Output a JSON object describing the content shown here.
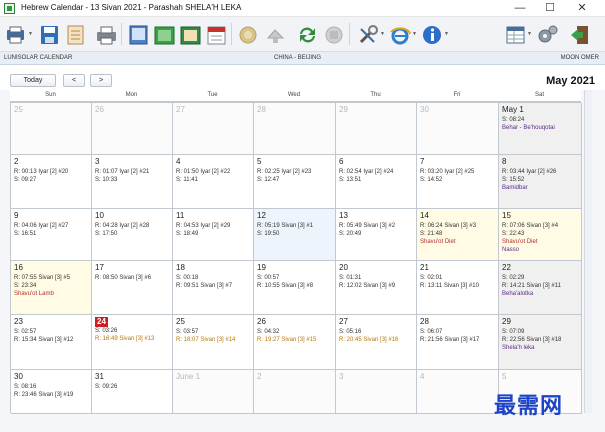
{
  "window": {
    "title": "Hebrew Calendar - 13 Sivan 2021 - Parashah SHELA'H LEKA"
  },
  "toolbar_icons": [
    "print-preview-icon",
    "save-icon",
    "open-file-icon",
    "print-icon",
    "tablet-icon",
    "green-calendar-icon",
    "tan-calendar-icon",
    "calendar-page-icon",
    "circle-disabled-icon",
    "lamp-disabled-icon",
    "refresh-icon",
    "stop-disabled-icon",
    "tools-icon",
    "gears-icon",
    "internet-explorer-icon",
    "info-icon",
    "table-view-icon",
    "settings-icon",
    "exit-door-icon"
  ],
  "infobar": {
    "left": "LUNISOLAR CALENDAR",
    "center": "CHINA - BEIJING",
    "right": "MOON OMER"
  },
  "nav": {
    "today": "Today",
    "prev": "<",
    "next": ">",
    "month_title": "May 2021"
  },
  "day_names": [
    "Sun",
    "Mon",
    "Tue",
    "Wed",
    "Thu",
    "Fri",
    "Sat"
  ],
  "colors": {
    "today_red": "#cc2020",
    "event_purple": "#5a2c86",
    "event_red": "#b03030",
    "event_orange": "#b8760a",
    "watermark_blue": "#1d43c8"
  },
  "weeks": [
    [
      {
        "day": "25",
        "out": true,
        "lines": [],
        "events": []
      },
      {
        "day": "26",
        "out": true,
        "lines": [],
        "events": []
      },
      {
        "day": "27",
        "out": true,
        "lines": [],
        "events": []
      },
      {
        "day": "28",
        "out": true,
        "lines": [],
        "events": []
      },
      {
        "day": "29",
        "out": true,
        "lines": [],
        "events": []
      },
      {
        "day": "30",
        "out": true,
        "lines": [],
        "events": []
      },
      {
        "day": "May 1",
        "style": "shaded",
        "lines": [
          "S: 08:24"
        ],
        "events": [
          {
            "text": "Behar - Be'houqotai",
            "color": "purple"
          }
        ]
      }
    ],
    [
      {
        "day": "2",
        "lines": [
          "R: 00:13 Iyar [2] #20",
          "S: 09:27"
        ],
        "events": []
      },
      {
        "day": "3",
        "lines": [
          "R: 01:07 Iyar [2] #21",
          "S: 10:33"
        ],
        "events": []
      },
      {
        "day": "4",
        "lines": [
          "R: 01:50 Iyar [2] #22",
          "S: 11:41"
        ],
        "events": []
      },
      {
        "day": "5",
        "lines": [
          "R: 02:25 Iyar [2] #23",
          "S: 12:47"
        ],
        "events": []
      },
      {
        "day": "6",
        "lines": [
          "R: 02:54 Iyar [2] #24",
          "S: 13:51"
        ],
        "events": []
      },
      {
        "day": "7",
        "lines": [
          "R: 03:20 Iyar [2] #25",
          "S: 14:52"
        ],
        "events": []
      },
      {
        "day": "8",
        "style": "shaded",
        "lines": [
          "R: 03:44 Iyar [2] #26",
          "S: 15:52"
        ],
        "events": [
          {
            "text": "Bamidbar",
            "color": "purple"
          }
        ]
      }
    ],
    [
      {
        "day": "9",
        "lines": [
          "R: 04:06 Iyar [2] #27",
          "S: 16:51"
        ],
        "events": []
      },
      {
        "day": "10",
        "lines": [
          "R: 04:28 Iyar [2] #28",
          "S: 17:50"
        ],
        "events": []
      },
      {
        "day": "11",
        "lines": [
          "R: 04:53 Iyar [2] #29",
          "S: 18:49"
        ],
        "events": []
      },
      {
        "day": "12",
        "style": "blue",
        "lines": [
          "R: 05:19 Sivan [3] #1",
          "S: 19:50"
        ],
        "events": []
      },
      {
        "day": "13",
        "lines": [
          "R: 05:49 Sivan [3] #2",
          "S: 20:49"
        ],
        "events": []
      },
      {
        "day": "14",
        "style": "yellow",
        "lines": [
          "R: 06:24 Sivan [3] #3",
          "S: 21:48"
        ],
        "events": [
          {
            "text": "Shavu'ot Diet",
            "color": "red"
          }
        ]
      },
      {
        "day": "15",
        "style": "yellow",
        "lines": [
          "R: 07:06 Sivan [3] #4",
          "S: 22:43"
        ],
        "events": [
          {
            "text": "Shavu'ot Diet",
            "color": "red"
          },
          {
            "text": "Nasso",
            "color": "purple"
          }
        ]
      }
    ],
    [
      {
        "day": "16",
        "style": "yellow",
        "lines": [
          "R: 07:55 Sivan [3] #5",
          "S: 23:34"
        ],
        "events": [
          {
            "text": "Shavu'ot Lamb",
            "color": "red"
          }
        ]
      },
      {
        "day": "17",
        "lines": [
          "R: 08:50 Sivan [3] #6"
        ],
        "events": []
      },
      {
        "day": "18",
        "lines": [
          "S: 00:18",
          "R: 09:51 Sivan [3] #7"
        ],
        "events": []
      },
      {
        "day": "19",
        "lines": [
          "S: 00:57",
          "R: 10:55 Sivan [3] #8"
        ],
        "events": []
      },
      {
        "day": "20",
        "lines": [
          "S: 01:31",
          "R: 12:02 Sivan [3] #9"
        ],
        "events": []
      },
      {
        "day": "21",
        "lines": [
          "S: 02:01",
          "R: 13:11 Sivan [3] #10"
        ],
        "events": []
      },
      {
        "day": "22",
        "style": "shaded",
        "lines": [
          "S: 02:29",
          "R: 14:21 Sivan [3] #11"
        ],
        "events": [
          {
            "text": "Beha'alotka",
            "color": "purple"
          }
        ]
      }
    ],
    [
      {
        "day": "23",
        "lines": [
          "S: 02:57",
          "R: 15:34 Sivan [3] #12"
        ],
        "events": []
      },
      {
        "day": "24",
        "today": true,
        "lines": [
          "S: 03:26"
        ],
        "events": [
          {
            "text": "R: 16:49 Sivan [3] #13",
            "color": "orange"
          }
        ]
      },
      {
        "day": "25",
        "lines": [
          "S: 03:57"
        ],
        "events": [
          {
            "text": "R: 18:07 Sivan [3] #14",
            "color": "orange"
          }
        ]
      },
      {
        "day": "26",
        "lines": [
          "S: 04:32"
        ],
        "events": [
          {
            "text": "R: 19:27 Sivan [3] #15",
            "color": "orange"
          }
        ]
      },
      {
        "day": "27",
        "lines": [
          "S: 05:16"
        ],
        "events": [
          {
            "text": "R: 20:45 Sivan [3] #16",
            "color": "orange"
          }
        ]
      },
      {
        "day": "28",
        "lines": [
          "S: 06:07",
          "R: 21:56 Sivan [3] #17"
        ],
        "events": []
      },
      {
        "day": "29",
        "style": "shaded",
        "lines": [
          "S: 07:09",
          "R: 22:56 Sivan [3] #18"
        ],
        "events": [
          {
            "text": "Shela'h leka",
            "color": "purple"
          }
        ]
      }
    ],
    [
      {
        "day": "30",
        "lines": [
          "S: 08:16",
          "R: 23:46 Sivan [3] #19"
        ],
        "events": []
      },
      {
        "day": "31",
        "lines": [
          "S: 09:26"
        ],
        "events": []
      },
      {
        "day": "June 1",
        "out": true,
        "lines": [],
        "events": []
      },
      {
        "day": "2",
        "out": true,
        "lines": [],
        "events": []
      },
      {
        "day": "3",
        "out": true,
        "lines": [],
        "events": []
      },
      {
        "day": "4",
        "out": true,
        "lines": [],
        "events": []
      },
      {
        "day": "5",
        "out": true,
        "lines": [],
        "events": []
      }
    ]
  ],
  "watermark": "最需网"
}
